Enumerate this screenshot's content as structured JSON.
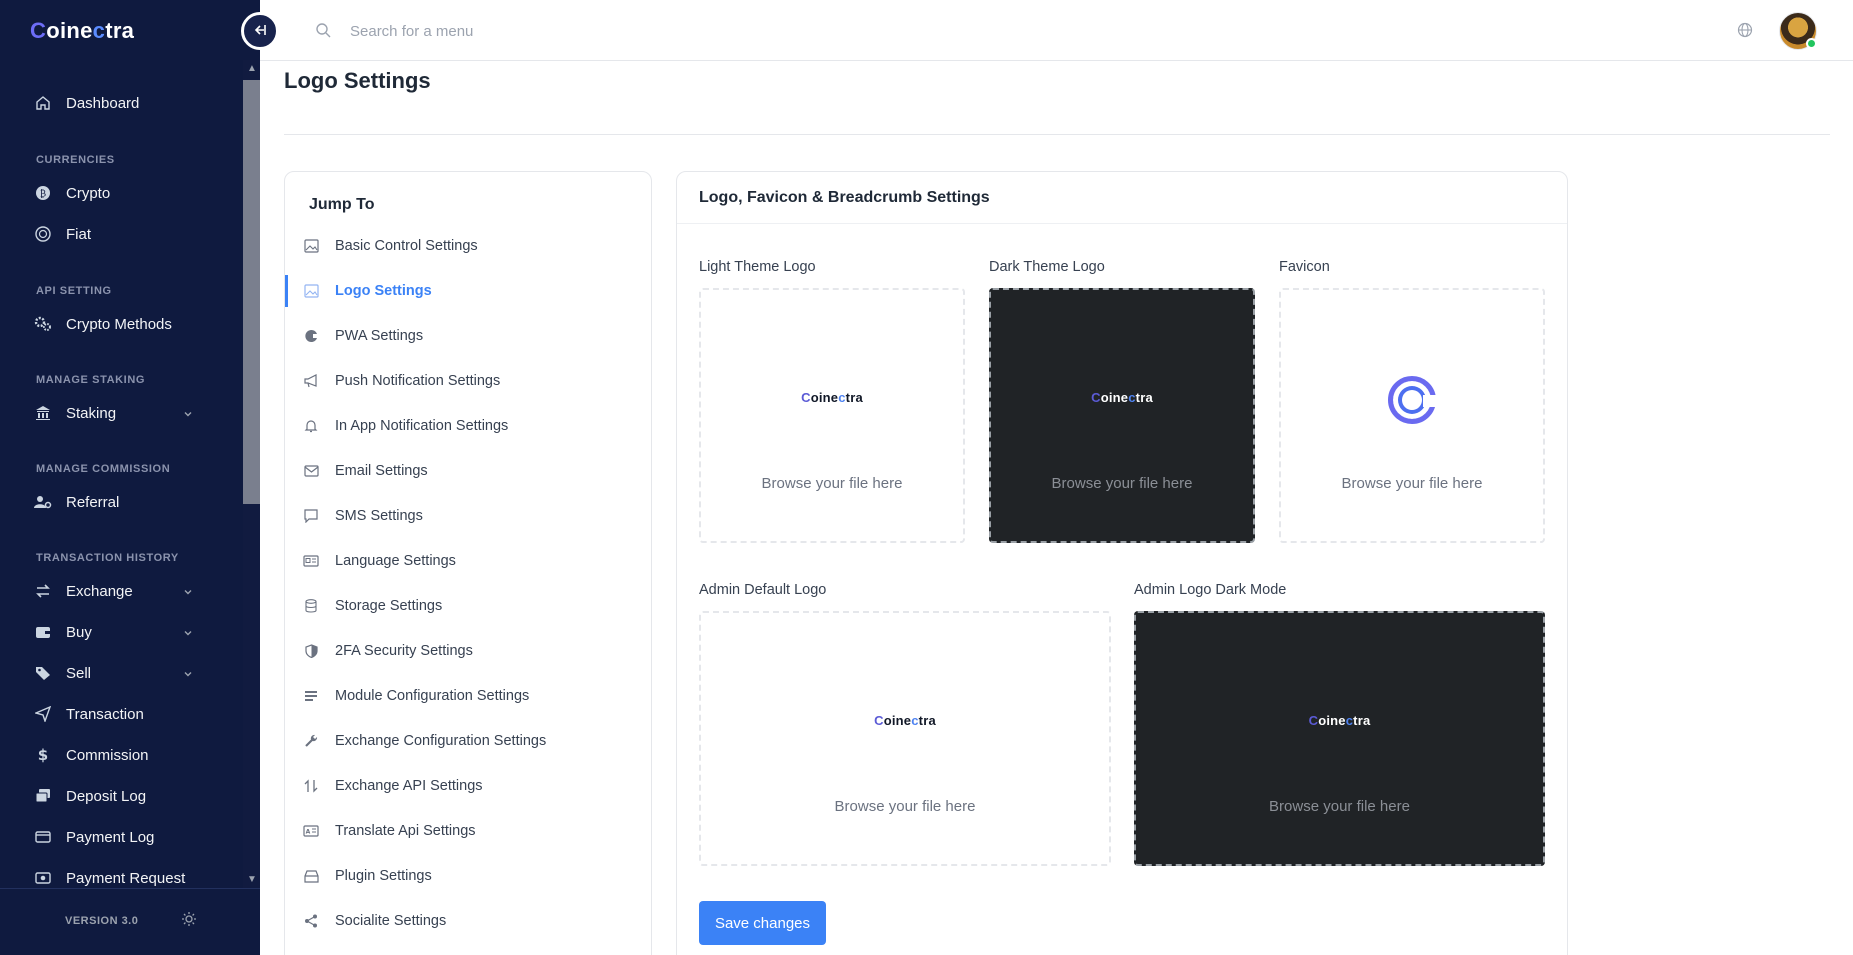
{
  "brand": {
    "c": "C",
    "name_a": "oine",
    "name_b": "c",
    "name_c": "tra"
  },
  "header": {
    "search_placeholder": "Search for a menu"
  },
  "sidebar": {
    "dashboard": "Dashboard",
    "sections": {
      "currencies": "CURRENCIES",
      "api": "API SETTING",
      "staking": "MANAGE STAKING",
      "commission": "MANAGE COMMISSION",
      "history": "TRANSACTION HISTORY"
    },
    "items": {
      "crypto": "Crypto",
      "fiat": "Fiat",
      "crypto_methods": "Crypto Methods",
      "staking": "Staking",
      "referral": "Referral",
      "exchange": "Exchange",
      "buy": "Buy",
      "sell": "Sell",
      "transaction": "Transaction",
      "commission": "Commission",
      "deposit_log": "Deposit Log",
      "payment_log": "Payment Log",
      "payment_request": "Payment Request"
    },
    "version": "VERSION 3.0"
  },
  "page": {
    "title": "Logo Settings"
  },
  "jump": {
    "title": "Jump To",
    "items": [
      "Basic Control Settings",
      "Logo Settings",
      "PWA Settings",
      "Push Notification Settings",
      "In App Notification Settings",
      "Email Settings",
      "SMS Settings",
      "Language Settings",
      "Storage Settings",
      "2FA Security Settings",
      "Module Configuration Settings",
      "Exchange Configuration Settings",
      "Exchange API Settings",
      "Translate Api Settings",
      "Plugin Settings",
      "Socialite Settings"
    ]
  },
  "settings": {
    "title": "Logo, Favicon & Breadcrumb Settings",
    "light_logo": "Light Theme Logo",
    "dark_logo": "Dark Theme Logo",
    "favicon": "Favicon",
    "admin_logo": "Admin Default Logo",
    "admin_dark": "Admin Logo Dark Mode",
    "browse": "Browse your file here",
    "save": "Save changes"
  }
}
